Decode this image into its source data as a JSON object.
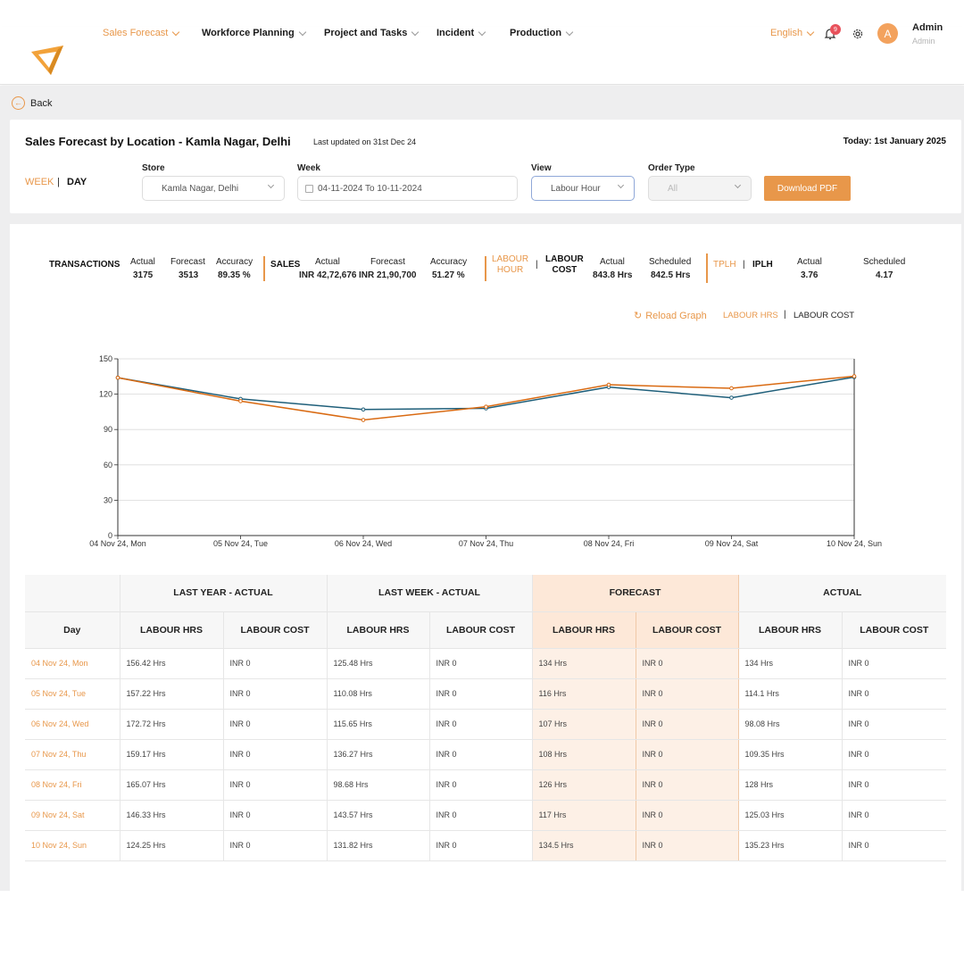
{
  "nav": {
    "items": [
      {
        "label": "Sales Forecast",
        "active": true
      },
      {
        "label": "Workforce Planning"
      },
      {
        "label": "Project and Tasks"
      },
      {
        "label": "Incident"
      },
      {
        "label": "Production"
      }
    ],
    "language": "English",
    "notification_count": "9",
    "avatar_letter": "A",
    "user_name": "Admin",
    "user_role": "Admin"
  },
  "back_label": "Back",
  "header": {
    "title": "Sales Forecast by Location - Kamla Nagar, Delhi",
    "last_updated": "Last updated on 31st Dec 24",
    "today": "Today: 1st January 2025"
  },
  "filters": {
    "week_toggle": "WEEK",
    "sep": "|",
    "day_toggle": "DAY",
    "store_label": "Store",
    "store_value": "Kamla Nagar, Delhi",
    "week_label": "Week",
    "week_value": "04-11-2024 To 10-11-2024",
    "view_label": "View",
    "view_value": "Labour Hour",
    "order_type_label": "Order Type",
    "order_type_value": "All",
    "download_label": "Download PDF"
  },
  "kpis": {
    "transactions": {
      "title": "TRANSACTIONS",
      "actual_label": "Actual",
      "actual": "3175",
      "forecast_label": "Forecast",
      "forecast": "3513",
      "accuracy_label": "Accuracy",
      "accuracy": "89.35 %"
    },
    "sales": {
      "title": "SALES",
      "actual_label": "Actual",
      "actual": "INR 42,72,676",
      "forecast_label": "Forecast",
      "forecast": "INR 21,90,700",
      "accuracy_label": "Accuracy",
      "accuracy": "51.27 %"
    },
    "labour": {
      "hour_line1": "LABOUR",
      "hour_line2": "HOUR",
      "sep": "|",
      "cost_line1": "LABOUR",
      "cost_line2": "COST",
      "actual_label": "Actual",
      "actual": "843.8 Hrs",
      "scheduled_label": "Scheduled",
      "scheduled": "842.5 Hrs"
    },
    "tplh": {
      "tplh": "TPLH",
      "sep": "|",
      "iplh": "IPLH",
      "actual_label": "Actual",
      "actual": "3.76",
      "scheduled_label": "Scheduled",
      "scheduled": "4.17"
    }
  },
  "graph_controls": {
    "reload": "Reload Graph",
    "labour_hrs": "LABOUR HRS",
    "sep": "|",
    "labour_cost": "LABOUR COST"
  },
  "chart_data": {
    "type": "line",
    "categories": [
      "04 Nov 24, Mon",
      "05 Nov 24, Tue",
      "06 Nov 24, Wed",
      "07 Nov 24, Thu",
      "08 Nov 24, Fri",
      "09 Nov 24, Sat",
      "10 Nov 24, Sun"
    ],
    "ylim": [
      0,
      150
    ],
    "yticks": [
      0,
      30,
      60,
      90,
      120,
      150
    ],
    "grid": true,
    "series": [
      {
        "values": [
          134,
          116,
          107,
          108,
          126,
          117,
          134.5
        ],
        "color": "#1f5f7a"
      },
      {
        "values": [
          134,
          114.1,
          98.08,
          109.35,
          128,
          125.03,
          135.23
        ],
        "color": "#d96a12"
      }
    ]
  },
  "table": {
    "group_headers": [
      "LAST YEAR - ACTUAL",
      "LAST WEEK - ACTUAL",
      "FORECAST",
      "ACTUAL"
    ],
    "day_header": "Day",
    "sub_headers": [
      "LABOUR HRS",
      "LABOUR COST",
      "LABOUR HRS",
      "LABOUR COST",
      "LABOUR HRS",
      "LABOUR COST",
      "LABOUR HRS",
      "LABOUR COST"
    ],
    "rows": [
      {
        "day": "04 Nov 24, Mon",
        "cells": [
          "156.42 Hrs",
          "INR 0",
          "125.48 Hrs",
          "INR 0",
          "134 Hrs",
          "INR 0",
          "134 Hrs",
          "INR 0"
        ]
      },
      {
        "day": "05 Nov 24, Tue",
        "cells": [
          "157.22 Hrs",
          "INR 0",
          "110.08 Hrs",
          "INR 0",
          "116 Hrs",
          "INR 0",
          "114.1 Hrs",
          "INR 0"
        ]
      },
      {
        "day": "06 Nov 24, Wed",
        "cells": [
          "172.72 Hrs",
          "INR 0",
          "115.65 Hrs",
          "INR 0",
          "107 Hrs",
          "INR 0",
          "98.08 Hrs",
          "INR 0"
        ]
      },
      {
        "day": "07 Nov 24, Thu",
        "cells": [
          "159.17 Hrs",
          "INR 0",
          "136.27 Hrs",
          "INR 0",
          "108 Hrs",
          "INR 0",
          "109.35 Hrs",
          "INR 0"
        ]
      },
      {
        "day": "08 Nov 24, Fri",
        "cells": [
          "165.07 Hrs",
          "INR 0",
          "98.68 Hrs",
          "INR 0",
          "126 Hrs",
          "INR 0",
          "128 Hrs",
          "INR 0"
        ]
      },
      {
        "day": "09 Nov 24, Sat",
        "cells": [
          "146.33 Hrs",
          "INR 0",
          "143.57 Hrs",
          "INR 0",
          "117 Hrs",
          "INR 0",
          "125.03 Hrs",
          "INR 0"
        ]
      },
      {
        "day": "10 Nov 24, Sun",
        "cells": [
          "124.25 Hrs",
          "INR 0",
          "131.82 Hrs",
          "INR 0",
          "134.5 Hrs",
          "INR 0",
          "135.23 Hrs",
          "INR 0"
        ]
      }
    ]
  }
}
